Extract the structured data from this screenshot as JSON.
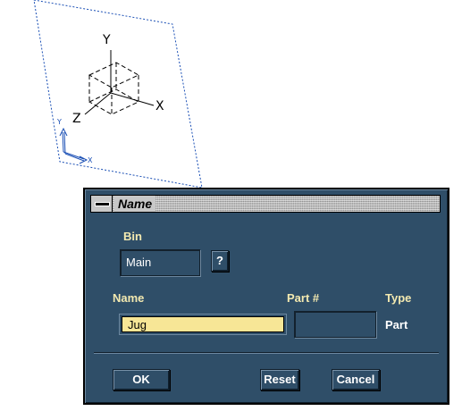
{
  "viewport": {
    "axes": {
      "x_label": "X",
      "y_label": "Y",
      "z_label": "Z"
    },
    "ucs": {
      "x_label": "X",
      "y_label": "Y"
    }
  },
  "dialog": {
    "title": "Name",
    "bin": {
      "label": "Bin",
      "value": "Main",
      "help_label": "?"
    },
    "name": {
      "label": "Name",
      "value": "Jug"
    },
    "part_number": {
      "label": "Part #",
      "value": ""
    },
    "type": {
      "label": "Type",
      "value": "Part"
    },
    "buttons": {
      "ok": "OK",
      "reset": "Reset",
      "cancel": "Cancel"
    }
  },
  "colors": {
    "dialog_bg": "#2f4e68",
    "label_text": "#f3e9b0",
    "active_field": "#f7e696",
    "ucs_blue": "#1a4fb5"
  }
}
